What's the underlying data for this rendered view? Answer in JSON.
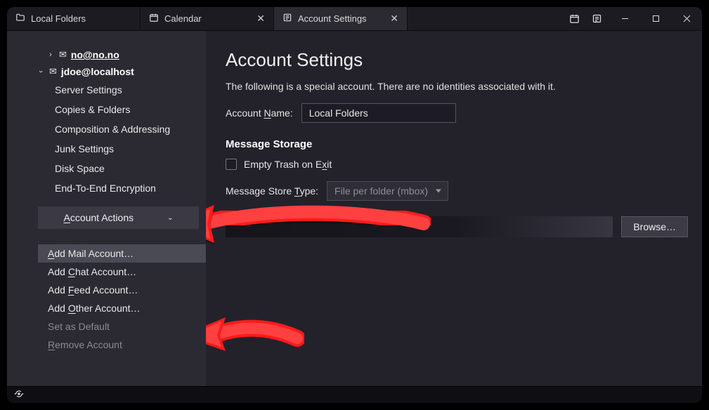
{
  "tabs": {
    "local_folders": "Local Folders",
    "calendar": "Calendar",
    "account_settings": "Account Settings"
  },
  "sidebar": {
    "accounts": [
      {
        "email": "no@no.no",
        "expanded": false
      },
      {
        "email": "jdoe@localhost",
        "expanded": true
      }
    ],
    "subs": {
      "server": "Server Settings",
      "copies": "Copies & Folders",
      "composition": "Composition & Addressing",
      "junk": "Junk Settings",
      "disk": "Disk Space",
      "e2e": "End-To-End Encryption"
    },
    "menu": {
      "add_mail": "Add Mail Account…",
      "add_chat": "Add Chat Account…",
      "add_feed": "Add Feed Account…",
      "add_other": "Add Other Account…",
      "set_default": "Set as Default",
      "remove": "Remove Account"
    },
    "account_actions": "Account Actions"
  },
  "content": {
    "heading": "Account Settings",
    "description": "The following is a special account. There are no identities associated with it.",
    "account_name_label": "Account Name:",
    "account_name_value": "Local Folders",
    "message_storage_heading": "Message Storage",
    "empty_trash_label": "Empty Trash on Exit",
    "store_type_label": "Message Store Type:",
    "store_type_value": "File per folder (mbox)",
    "browse_label": "Browse…"
  }
}
